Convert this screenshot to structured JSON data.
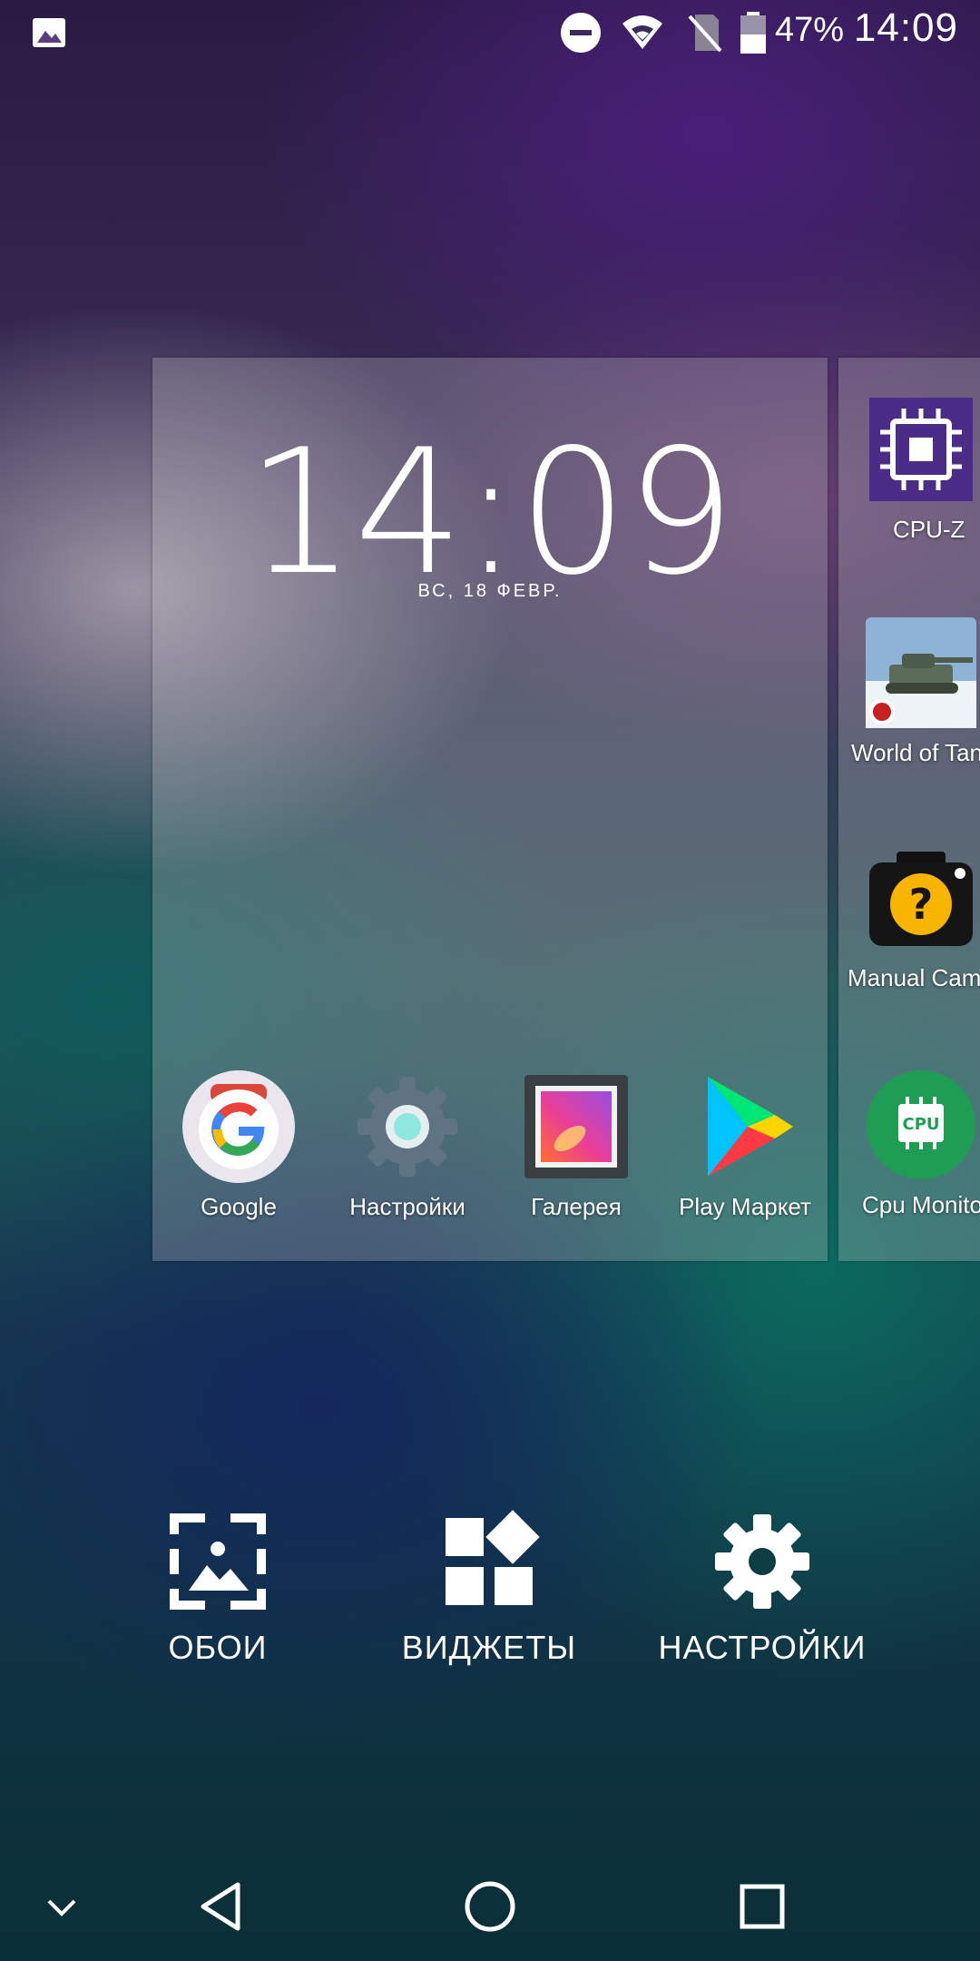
{
  "status_bar": {
    "battery_percent": "47%",
    "time": "14:09",
    "icons": [
      "image-notification-icon",
      "dnd-icon",
      "wifi-icon",
      "no-sim-icon",
      "battery-icon"
    ]
  },
  "widget": {
    "time": "14:09",
    "date": "ВС, 18 ФЕВР."
  },
  "dock_apps": [
    {
      "label": "Google",
      "icon": "google-icon"
    },
    {
      "label": "Настройки",
      "icon": "settings-app-icon"
    },
    {
      "label": "Галерея",
      "icon": "gallery-icon"
    },
    {
      "label": "Play Маркет",
      "icon": "play-store-icon"
    }
  ],
  "next_page_apps": [
    {
      "label": "CPU-Z",
      "icon": "cpu-z-icon"
    },
    {
      "label": "World of Tank",
      "icon": "world-of-tanks-icon"
    },
    {
      "label": "Manual Came",
      "icon": "manual-camera-icon"
    },
    {
      "label": "Cpu Monito",
      "icon": "cpu-monitor-icon"
    }
  ],
  "options": [
    {
      "label": "ОБОИ",
      "icon": "wallpaper-icon"
    },
    {
      "label": "ВИДЖЕТЫ",
      "icon": "widgets-icon"
    },
    {
      "label": "НАСТРОЙКИ",
      "icon": "settings-gear-icon"
    }
  ],
  "nav_bar": [
    "hide-chevron-icon",
    "back-icon",
    "home-icon",
    "recents-icon"
  ],
  "colors": {
    "google_red": "#ea4335",
    "google_blue": "#4285f4",
    "google_yellow": "#fbbc05",
    "google_green": "#34a853",
    "cpuz_purple": "#4b2c86",
    "cpu_monitor_green": "#1f9d55"
  }
}
